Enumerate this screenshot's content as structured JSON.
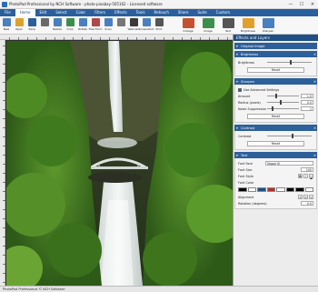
{
  "window": {
    "title": "PhotoPad Professional by NCH Software - photo-pixabay-505162 - Licensed software",
    "minimize": "—",
    "maximize": "☐",
    "close": "✕"
  },
  "menu": {
    "items": [
      "File",
      "Home",
      "Edit",
      "Select",
      "Color",
      "Filters",
      "Effects",
      "Tools",
      "Retouch",
      "Share",
      "Suite",
      "Custom"
    ],
    "active_index": 1
  },
  "toolbar": {
    "items": [
      {
        "label": "New",
        "icon": "new-icon",
        "color": "#4a7fc1"
      },
      {
        "label": "Open",
        "icon": "open-icon",
        "color": "#e0a12a"
      },
      {
        "label": "Save",
        "icon": "save-icon",
        "color": "#2d5f9a"
      },
      {
        "label": "",
        "icon": "undo-icon",
        "color": "#6a6a6a"
      },
      {
        "label": "Resize",
        "icon": "resize-icon",
        "color": "#4a7fc1"
      },
      {
        "label": "Crop",
        "icon": "crop-icon",
        "color": "#3c8f4a"
      },
      {
        "label": "Rotate",
        "icon": "rotate-icon",
        "color": "#4a7fc1"
      },
      {
        "label": "Free Form",
        "icon": "freeform-icon",
        "color": "#b04848"
      },
      {
        "label": "Scan",
        "icon": "scan-icon",
        "color": "#4a7fc1"
      },
      {
        "label": "",
        "icon": "webcam-icon",
        "color": "#777777"
      },
      {
        "label": "Webcam",
        "icon": "webcam2-icon",
        "color": "#3a3a3a"
      },
      {
        "label": "Screenshot",
        "icon": "screenshot-icon",
        "color": "#4a7fc1"
      },
      {
        "label": "Print",
        "icon": "print-icon",
        "color": "#555555"
      },
      {
        "label": "",
        "icon": "blank-icon",
        "color": "#f7f7f7"
      },
      {
        "label": "Collage",
        "icon": "collage-icon",
        "color": "#c6502f"
      },
      {
        "label": "Image",
        "icon": "image-icon",
        "color": "#3c8f4a"
      },
      {
        "label": "Text",
        "icon": "text-icon",
        "color": "#555555"
      },
      {
        "label": "Brightness",
        "icon": "brightness-icon",
        "color": "#e0a12a"
      },
      {
        "label": "Sharpen",
        "icon": "sharpen-icon",
        "color": "#4a7fc1"
      }
    ]
  },
  "panel": {
    "header": "Effects and Layers",
    "original_image": "Original Image",
    "brightness": {
      "title": "Brightness",
      "label": "Brightness",
      "level": 0.5,
      "reset": "Reset"
    },
    "sharpen": {
      "title": "Sharpen",
      "use_advanced": "Use Advanced Settings",
      "amount_label": "Amount",
      "amount_value": "1.0",
      "amount_level": 0.25,
      "radius_label": "Radius (pixels)",
      "radius_value": "5.0",
      "radius_level": 0.4,
      "noise_label": "Noise Suppression",
      "noise_value": "1",
      "noise_level": 0.15,
      "reset": "Reset"
    },
    "contrast": {
      "title": "Contrast",
      "label": "Contrast",
      "level": 0.55,
      "reset": "Reset"
    },
    "text": {
      "title": "Text",
      "font_face_label": "Font Face",
      "font_face_value": "Segoe UI",
      "font_size_label": "Font Size",
      "font_size_value": "100",
      "font_style_label": "Font Style",
      "font_color_label": "Font Color",
      "swatches": [
        "#000000",
        "#ffffff",
        "#1f4f86",
        "#b03030",
        "#ffffff",
        "#000000",
        "#000000",
        "#ffffff"
      ],
      "alignment_label": "Alignment",
      "rotation_label": "Rotation (degrees)",
      "rotation_value": "0.0"
    }
  },
  "status": {
    "text": "PhotoPad Professional © NCH Software"
  }
}
